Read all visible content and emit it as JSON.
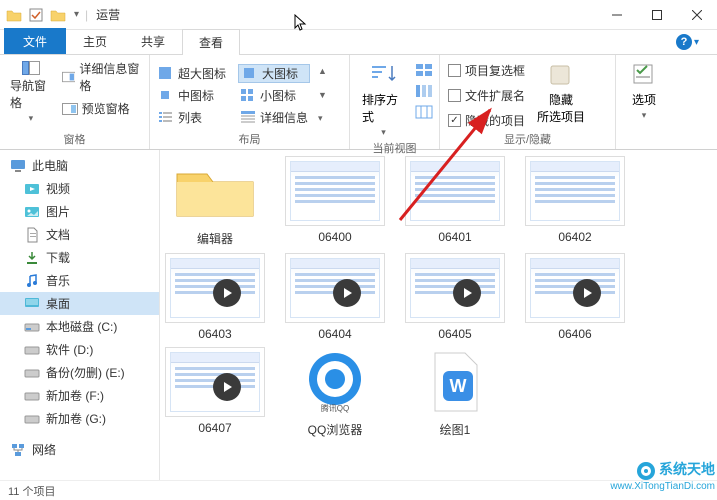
{
  "window": {
    "title": "运营"
  },
  "tabs": {
    "file": "文件",
    "home": "主页",
    "share": "共享",
    "view": "查看"
  },
  "ribbon": {
    "panes": {
      "label": "窗格",
      "nav_pane": "导航窗格",
      "detail_pane": "详细信息窗格",
      "preview_pane": "预览窗格"
    },
    "layout": {
      "label": "布局",
      "xl_icons": "超大图标",
      "l_icons": "大图标",
      "m_icons": "中图标",
      "s_icons": "小图标",
      "list": "列表",
      "details": "详细信息"
    },
    "current_view": {
      "label": "当前视图",
      "sort": "排序方式"
    },
    "show_hide": {
      "label": "显示/隐藏",
      "item_checkboxes": "项目复选框",
      "file_ext": "文件扩展名",
      "hidden_items": "隐藏的项目",
      "hide_selected_top": "隐藏",
      "hide_selected_bottom": "所选项目"
    },
    "options": {
      "label": "选项"
    }
  },
  "nav": {
    "this_pc": "此电脑",
    "videos": "视频",
    "pictures": "图片",
    "documents": "文档",
    "downloads": "下载",
    "music": "音乐",
    "desktop": "桌面",
    "drive_c": "本地磁盘 (C:)",
    "drive_d": "软件 (D:)",
    "drive_e": "备份(勿删) (E:)",
    "drive_f": "新加卷 (F:)",
    "drive_g": "新加卷 (G:)",
    "network": "网络"
  },
  "files": [
    {
      "name": "编辑器",
      "type": "folder"
    },
    {
      "name": "06400",
      "type": "screenshot"
    },
    {
      "name": "06401",
      "type": "screenshot"
    },
    {
      "name": "06402",
      "type": "screenshot"
    },
    {
      "name": "06403",
      "type": "player"
    },
    {
      "name": "06404",
      "type": "player"
    },
    {
      "name": "06405",
      "type": "player"
    },
    {
      "name": "06406",
      "type": "player"
    },
    {
      "name": "06407",
      "type": "player"
    },
    {
      "name": "QQ浏览器",
      "type": "qq"
    },
    {
      "name": "绘图1",
      "type": "wps"
    }
  ],
  "status": {
    "count": "11 个项目"
  },
  "watermark": {
    "line1": "系统天地",
    "line2": "www.XiTongTianDi.com"
  }
}
